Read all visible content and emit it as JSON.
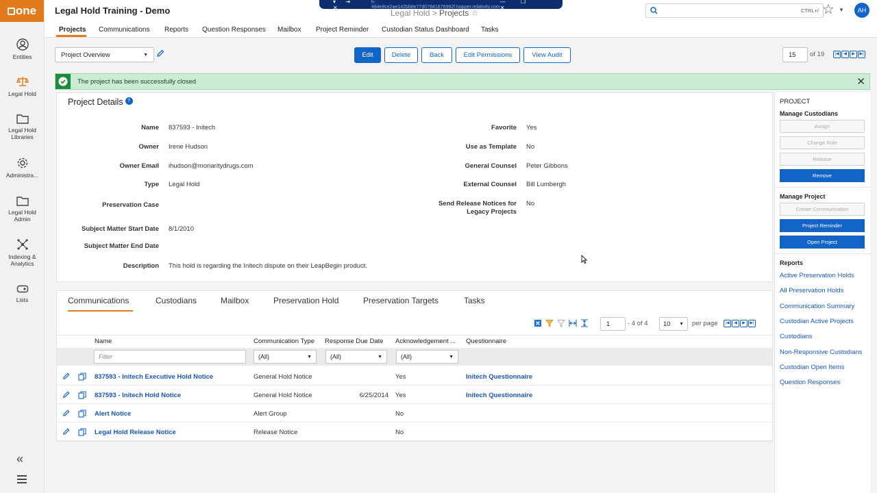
{
  "app": {
    "logo_text": "one",
    "title": "Legal Hold Training - Demo"
  },
  "window_bar": {
    "controls": "▾ ⇥ ✕",
    "url": "h-484e9ce2ae142bb8e77d07841676992f.hopper.relativity.com",
    "win_controls": "— ❐ ✕"
  },
  "breadcrumb": {
    "parent": "Legal Hold",
    "sep": " > ",
    "current": "Projects"
  },
  "search": {
    "placeholder": "",
    "shortcut": "CTRL+/"
  },
  "user": {
    "initials": "AH"
  },
  "sidebar": {
    "items": [
      {
        "label": "Entities",
        "icon": "person-circle-icon"
      },
      {
        "label": "Legal Hold",
        "icon": "scales-icon"
      },
      {
        "label": "Legal Hold Libraries",
        "icon": "folder-icon"
      },
      {
        "label": "Administra...",
        "icon": "gear-icon"
      },
      {
        "label": "Legal Hold Admin",
        "icon": "folder-icon"
      },
      {
        "label": "Indexing & Analytics",
        "icon": "network-icon"
      },
      {
        "label": "Lists",
        "icon": "tag-icon"
      }
    ]
  },
  "tabs": [
    "Projects",
    "Communications",
    "Reports",
    "Question Responses",
    "Mailbox",
    "Project Reminder",
    "Custodian Status Dashboard",
    "Tasks"
  ],
  "toolbar": {
    "view": "Project Overview",
    "buttons": [
      "Edit",
      "Delete",
      "Back",
      "Edit Permissions",
      "View Audit"
    ],
    "page_current": "15",
    "page_total": "of 19"
  },
  "alert": {
    "message": "The project has been successfully closed"
  },
  "details": {
    "title": "Project Details",
    "left": [
      {
        "label": "Name",
        "value": "837593 - Initech"
      },
      {
        "label": "Owner",
        "value": "Irene Hudson"
      },
      {
        "label": "Owner Email",
        "value": "ihudson@moriaritydrugs.com"
      },
      {
        "label": "Type",
        "value": "Legal Hold"
      },
      {
        "label": "Preservation Case",
        "value": ""
      },
      {
        "label": "Subject Matter Start Date",
        "value": "8/1/2010"
      },
      {
        "label": "Subject Matter End Date",
        "value": ""
      },
      {
        "label": "Description",
        "value": "This hold is regarding the Initech dispute on their LeapBegin product."
      }
    ],
    "right": [
      {
        "label": "Favorite",
        "value": "Yes"
      },
      {
        "label": "Use as Template",
        "value": "No"
      },
      {
        "label": "General Counsel",
        "value": "Peter Gibbons"
      },
      {
        "label": "External Counsel",
        "value": "Bill Lumbergh"
      },
      {
        "label": "Send Release Notices for",
        "label2": "Legacy Projects",
        "value": "No"
      }
    ]
  },
  "subtabs": [
    "Communications",
    "Custodians",
    "Mailbox",
    "Preservation Hold",
    "Preservation Targets",
    "Tasks"
  ],
  "grid": {
    "page": "1",
    "range": "- 4 of 4",
    "per_page": "10",
    "per_page_label": "per page",
    "columns": [
      "Name",
      "Communication Type",
      "Response Due Date",
      "Acknowledgement ...",
      "Questionnaire"
    ],
    "filter_placeholder": "Filter",
    "filter_all": "(All)",
    "rows": [
      {
        "name": "837593 - Initech Executive Hold Notice",
        "type": "General Hold Notice",
        "due": "",
        "ack": "Yes",
        "questionnaire": "Initech Questionnaire"
      },
      {
        "name": "837593 - Initech Hold Notice",
        "type": "General Hold Notice",
        "due": "6/25/2014",
        "ack": "Yes",
        "questionnaire": "Initech Questionnaire"
      },
      {
        "name": "Alert Notice",
        "type": "Alert Group",
        "due": "",
        "ack": "No",
        "questionnaire": ""
      },
      {
        "name": "Legal Hold Release Notice",
        "type": "Release Notice",
        "due": "",
        "ack": "No",
        "questionnaire": ""
      }
    ]
  },
  "right_panel": {
    "title": "PROJECT",
    "manage_custodians": "Manage Custodians",
    "custodian_buttons": [
      "Assign",
      "Change Role",
      "Release",
      "Remove"
    ],
    "manage_project": "Manage Project",
    "project_buttons": [
      "Create Communication",
      "Project Reminder",
      "Open Project"
    ],
    "reports_title": "Reports",
    "reports": [
      "Active Preservation Holds",
      "All Preservation Holds",
      "Communication Summary",
      "Custodian Active Projects",
      "Custodians",
      "Non-Responsive Custodians",
      "Custodian Open Items",
      "Question Responses"
    ]
  }
}
